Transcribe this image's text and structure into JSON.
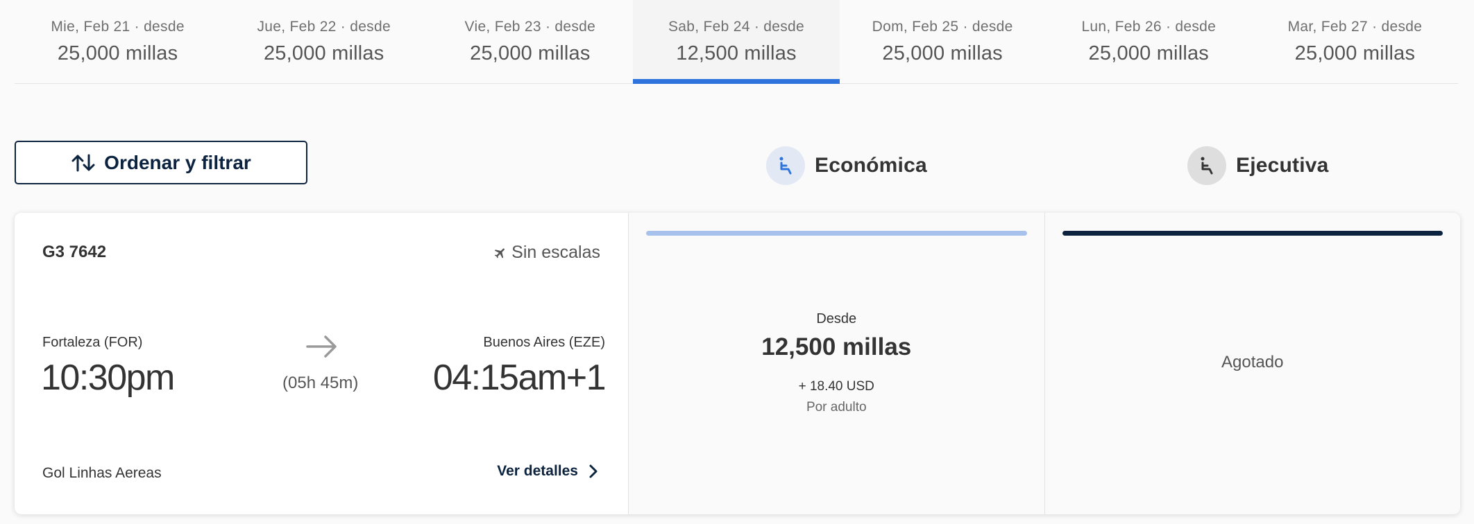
{
  "date_tabs": [
    {
      "label": "Mie, Feb 21 · desde",
      "price": "25,000 millas",
      "selected": false
    },
    {
      "label": "Jue, Feb 22 · desde",
      "price": "25,000 millas",
      "selected": false
    },
    {
      "label": "Vie, Feb 23 · desde",
      "price": "25,000 millas",
      "selected": false
    },
    {
      "label": "Sab, Feb 24 · desde",
      "price": "12,500 millas",
      "selected": true
    },
    {
      "label": "Dom, Feb 25 · desde",
      "price": "25,000 millas",
      "selected": false
    },
    {
      "label": "Lun, Feb 26 · desde",
      "price": "25,000 millas",
      "selected": false
    },
    {
      "label": "Mar, Feb 27 · desde",
      "price": "25,000 millas",
      "selected": false
    }
  ],
  "sort_filter": {
    "label": "Ordenar y filtrar",
    "icon": "sort-arrows-icon"
  },
  "cabins": {
    "economy": {
      "label": "Económica",
      "icon": "seat-icon"
    },
    "business": {
      "label": "Ejecutiva",
      "icon": "seat-icon"
    }
  },
  "flight": {
    "number": "G3 7642",
    "stops": "Sin escalas",
    "stops_icon": "plane-icon",
    "origin": {
      "name": "Fortaleza (FOR)",
      "time": "10:30pm"
    },
    "destination": {
      "name": "Buenos Aires (EZE)",
      "time": "04:15am+1"
    },
    "duration": "(05h 45m)",
    "airline": "Gol Linhas Aereas",
    "details_label": "Ver detalles"
  },
  "fares": {
    "economy": {
      "from_label": "Desde",
      "price": "12,500 millas",
      "taxes": "+ 18.40 USD",
      "per": "Por adulto"
    },
    "business": {
      "status": "Agotado"
    }
  },
  "colors": {
    "accent_blue": "#2e74dc",
    "navy": "#0c2340",
    "economy_bar": "#a7c1ed"
  }
}
